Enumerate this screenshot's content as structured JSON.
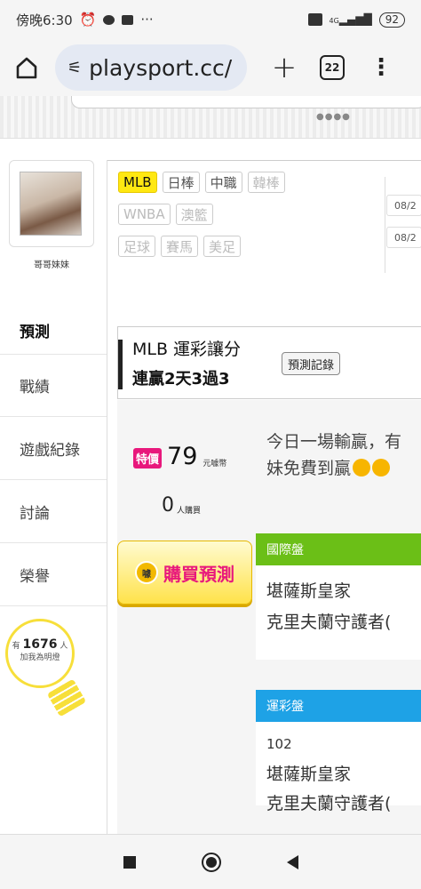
{
  "status_bar": {
    "time": "傍晚6:30",
    "more": "···",
    "battery": "92",
    "network": "4G"
  },
  "browser": {
    "url": "playsport.cc/",
    "tab_count": "22"
  },
  "profile": {
    "name": "哥哥妹妹"
  },
  "nav": [
    "預測",
    "戰績",
    "遊戲紀錄",
    "討論",
    "榮譽"
  ],
  "fans": {
    "prefix": "有",
    "count": "1676",
    "suffix": "人",
    "caption": "加我為明燈"
  },
  "categories": {
    "row1": [
      "MLB",
      "日棒",
      "中職",
      "韓棒"
    ],
    "row2": [
      "WNBA",
      "澳籃"
    ],
    "row3": [
      "足球",
      "賽馬",
      "美足"
    ]
  },
  "dates": [
    "08/2",
    "08/2"
  ],
  "header": {
    "title": "MLB 運彩讓分",
    "streak": "連贏2天3過3",
    "record_button": "預測記錄"
  },
  "price": {
    "badge": "特價",
    "amount": "79",
    "unit": "元噱幣"
  },
  "buyers": {
    "count": "0",
    "unit": "人購買"
  },
  "buy_button": {
    "label": "購買預測",
    "icon_text": "噱"
  },
  "description": {
    "line1": "今日一場輸贏，有",
    "line2": "妹免費到贏"
  },
  "intl_panel": {
    "label": "國際盤",
    "team1": "堪薩斯皇家",
    "team2": "克里夫蘭守護者("
  },
  "lottery_panel": {
    "label": "運彩盤",
    "game_no": "102",
    "team1": "堪薩斯皇家",
    "team2": "克里夫蘭守護者("
  },
  "colors": {
    "accent_yellow": "#ffe812",
    "pink": "#e8187c",
    "green": "#6bbf17",
    "blue": "#1ea2e6"
  }
}
